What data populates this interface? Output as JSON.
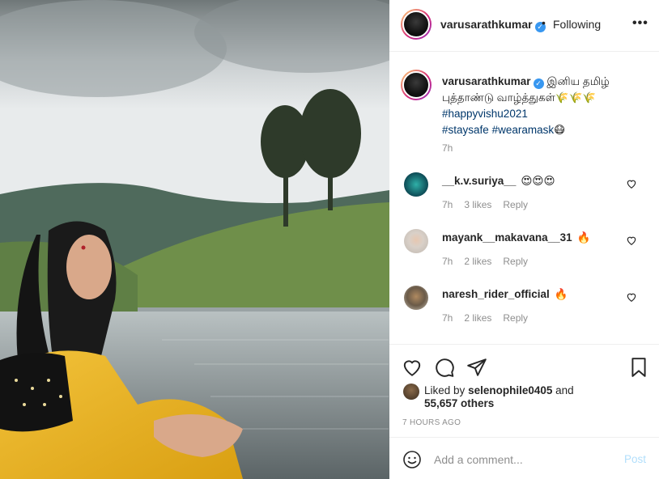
{
  "post": {
    "username": "varusarathkumar",
    "verified": true,
    "dot": "•",
    "following_label": "Following",
    "more_label": "•••"
  },
  "caption": {
    "username": "varusarathkumar",
    "text": "இனிய தமிழ் புத்தாண்டு வாழ்த்துகள்🌾🌾🌾",
    "hashtag1": "#happyvishu2021",
    "hashtag2": "#staysafe",
    "hashtag3": "#wearamask",
    "emoji_after": "😷",
    "time": "7h"
  },
  "comments": [
    {
      "username": "__k.v.suriya__",
      "text": "😍😍😍",
      "time": "7h",
      "likes": "3 likes",
      "reply": "Reply"
    },
    {
      "username": "mayank__makavana__31",
      "text": "🔥",
      "time": "7h",
      "likes": "2 likes",
      "reply": "Reply"
    },
    {
      "username": "naresh_rider_official",
      "text": "🔥",
      "time": "7h",
      "likes": "2 likes",
      "reply": "Reply"
    }
  ],
  "likes": {
    "prefix": "Liked by",
    "user": "selenophile0405",
    "and": "and",
    "count": "55,657 others"
  },
  "timestamp": "7 HOURS AGO",
  "add_comment": {
    "placeholder": "Add a comment...",
    "post_label": "Post"
  },
  "colors": {
    "accent_blue": "#3897f0",
    "post_button_disabled": "#b2dffc",
    "meta_gray": "#8e8e8e",
    "text": "#262626"
  },
  "icons": [
    "more-icon",
    "verified-icon",
    "heart-icon",
    "comment-icon",
    "share-icon",
    "bookmark-icon",
    "emoji-icon"
  ]
}
